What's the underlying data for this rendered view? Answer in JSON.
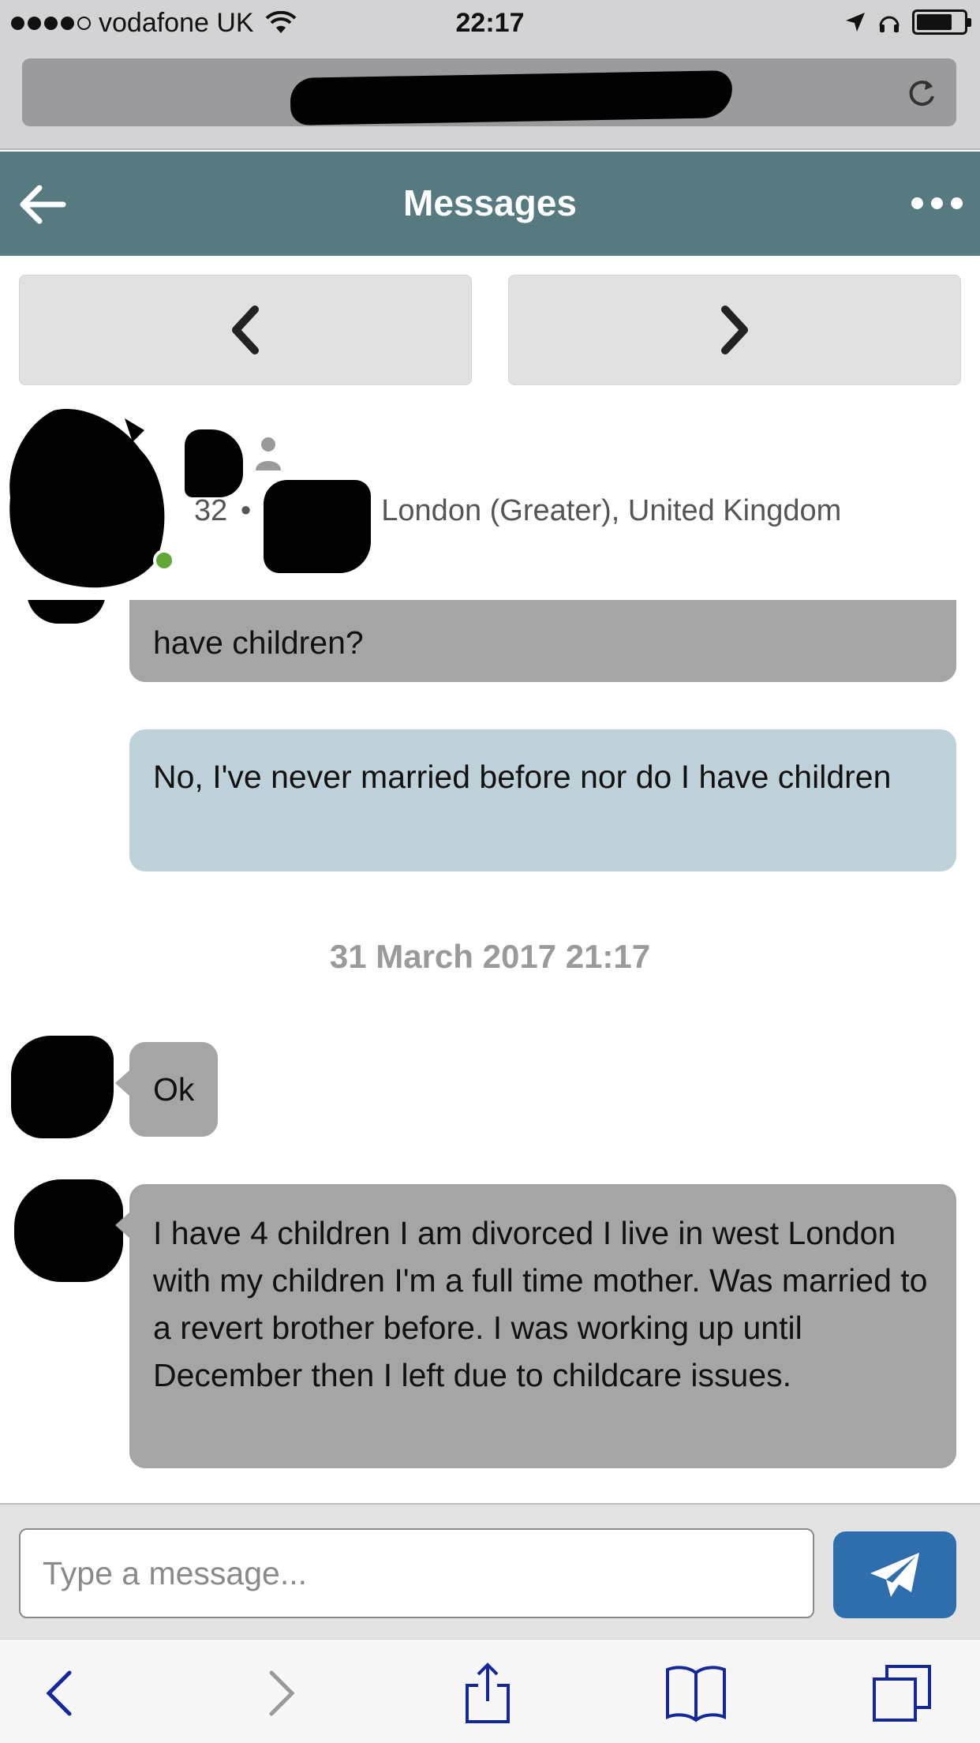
{
  "status_bar": {
    "carrier": "vodafone UK",
    "time": "22:17",
    "signal_bars_filled": 4,
    "signal_bars_total": 5,
    "battery_level": 0.75
  },
  "header": {
    "title": "Messages",
    "color": "#577a80"
  },
  "profile": {
    "age": "32",
    "separator": "•",
    "location": "London (Greater), United Kingdom",
    "online": true
  },
  "messages": [
    {
      "direction": "in",
      "text": "Have you been married before and do you have children?"
    },
    {
      "direction": "out",
      "text": "No, I've never married before nor do I have children"
    },
    {
      "direction": "in",
      "text": "Ok"
    },
    {
      "direction": "in",
      "text": "I have 4 children I am divorced I live in west London with my children I'm a full time mother. Was married to a revert brother before. I was working up until December then I left due to childcare issues."
    }
  ],
  "visible_first_message_tail": "have children?",
  "date_separator": "31 March 2017 21:17",
  "composer": {
    "placeholder": "Type a message...",
    "send_color": "#2f6ead"
  },
  "icons": {
    "back": "arrow-left-icon",
    "more": "ellipsis-icon",
    "prev": "chevron-left-icon",
    "next": "chevron-right-icon",
    "send": "paper-plane-icon",
    "reload": "reload-icon",
    "share": "share-icon",
    "bookmarks": "book-icon",
    "tabs": "tabs-icon"
  }
}
